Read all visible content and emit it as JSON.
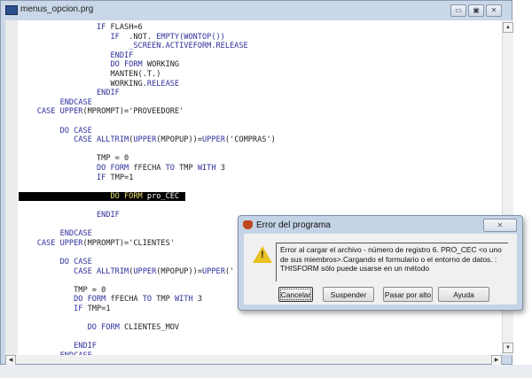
{
  "window": {
    "title": "menus_opcion.prg",
    "minimize": "▭",
    "maximize": "▣",
    "close": "✕"
  },
  "code_lines": [
    {
      "indent": 17,
      "segs": [
        {
          "t": "IF ",
          "k": "kw"
        },
        {
          "t": "FLASH=6",
          "k": ""
        }
      ]
    },
    {
      "indent": 20,
      "segs": [
        {
          "t": "IF  ",
          "k": "kw"
        },
        {
          "t": ".NOT. ",
          "k": ""
        },
        {
          "t": "EMPTY(WONTOP())",
          "k": "kw"
        }
      ]
    },
    {
      "indent": 24,
      "segs": [
        {
          "t": "_SCREEN.ACTIVEFORM.RELEASE",
          "k": "kw"
        }
      ]
    },
    {
      "indent": 20,
      "segs": [
        {
          "t": "ENDIF",
          "k": "kw"
        }
      ]
    },
    {
      "indent": 20,
      "segs": [
        {
          "t": "DO FORM ",
          "k": "kw"
        },
        {
          "t": "WORKING",
          "k": ""
        }
      ]
    },
    {
      "indent": 20,
      "segs": [
        {
          "t": "MANTEN(.T.)",
          "k": ""
        }
      ]
    },
    {
      "indent": 20,
      "segs": [
        {
          "t": "WORKING.",
          "k": ""
        },
        {
          "t": "RELEASE",
          "k": "kw"
        }
      ]
    },
    {
      "indent": 17,
      "segs": [
        {
          "t": "ENDIF",
          "k": "kw"
        }
      ]
    },
    {
      "indent": 9,
      "segs": [
        {
          "t": "ENDCASE",
          "k": "kw"
        }
      ]
    },
    {
      "indent": 4,
      "segs": [
        {
          "t": "CASE UPPER",
          "k": "kw"
        },
        {
          "t": "(MPROMPT)='PROVEEDORE'",
          "k": ""
        }
      ]
    },
    {
      "indent": 0,
      "segs": []
    },
    {
      "indent": 9,
      "segs": [
        {
          "t": "DO CASE",
          "k": "kw"
        }
      ]
    },
    {
      "indent": 12,
      "segs": [
        {
          "t": "CASE ALLTRIM",
          "k": "kw"
        },
        {
          "t": "(",
          "k": ""
        },
        {
          "t": "UPPER",
          "k": "kw"
        },
        {
          "t": "(MPOPUP))=",
          "k": ""
        },
        {
          "t": "UPPER",
          "k": "kw"
        },
        {
          "t": "('COMPRAS')",
          "k": ""
        }
      ]
    },
    {
      "indent": 0,
      "segs": []
    },
    {
      "indent": 17,
      "segs": [
        {
          "t": "TMP = 0",
          "k": ""
        }
      ]
    },
    {
      "indent": 17,
      "segs": [
        {
          "t": "DO FORM ",
          "k": "kw"
        },
        {
          "t": "fFECHA ",
          "k": ""
        },
        {
          "t": "TO ",
          "k": "kw"
        },
        {
          "t": "TMP ",
          "k": ""
        },
        {
          "t": "WITH ",
          "k": "kw"
        },
        {
          "t": "3",
          "k": ""
        }
      ]
    },
    {
      "indent": 17,
      "segs": [
        {
          "t": "IF ",
          "k": "kw"
        },
        {
          "t": "TMP=1",
          "k": ""
        }
      ]
    },
    {
      "indent": 0,
      "segs": []
    },
    {
      "indent": 20,
      "highlight": true,
      "segs": [
        {
          "t": "DO FORM ",
          "k": "kw"
        },
        {
          "t": "pro_CEC",
          "k": ""
        }
      ]
    },
    {
      "indent": 0,
      "segs": []
    },
    {
      "indent": 17,
      "segs": [
        {
          "t": "ENDIF",
          "k": "kw"
        }
      ]
    },
    {
      "indent": 0,
      "segs": []
    },
    {
      "indent": 9,
      "segs": [
        {
          "t": "ENDCASE",
          "k": "kw"
        }
      ]
    },
    {
      "indent": 4,
      "segs": [
        {
          "t": "CASE UPPER",
          "k": "kw"
        },
        {
          "t": "(MPROMPT)='CLIENTES'",
          "k": ""
        }
      ]
    },
    {
      "indent": 0,
      "segs": []
    },
    {
      "indent": 9,
      "segs": [
        {
          "t": "DO CASE",
          "k": "kw"
        }
      ]
    },
    {
      "indent": 12,
      "segs": [
        {
          "t": "CASE ALLTRIM",
          "k": "kw"
        },
        {
          "t": "(",
          "k": ""
        },
        {
          "t": "UPPER",
          "k": "kw"
        },
        {
          "t": "(MPOPUP))=",
          "k": ""
        },
        {
          "t": "UPPER",
          "k": "kw"
        },
        {
          "t": "('",
          "k": ""
        }
      ]
    },
    {
      "indent": 0,
      "segs": []
    },
    {
      "indent": 12,
      "segs": [
        {
          "t": "TMP = 0",
          "k": ""
        }
      ]
    },
    {
      "indent": 12,
      "segs": [
        {
          "t": "DO FORM ",
          "k": "kw"
        },
        {
          "t": "fFECHA ",
          "k": ""
        },
        {
          "t": "TO ",
          "k": "kw"
        },
        {
          "t": "TMP ",
          "k": ""
        },
        {
          "t": "WITH ",
          "k": "kw"
        },
        {
          "t": "3",
          "k": ""
        }
      ]
    },
    {
      "indent": 12,
      "segs": [
        {
          "t": "IF ",
          "k": "kw"
        },
        {
          "t": "TMP=1",
          "k": ""
        }
      ]
    },
    {
      "indent": 0,
      "segs": []
    },
    {
      "indent": 15,
      "segs": [
        {
          "t": "DO FORM ",
          "k": "kw"
        },
        {
          "t": "CLIENTES_MOV",
          "k": ""
        }
      ]
    },
    {
      "indent": 0,
      "segs": []
    },
    {
      "indent": 12,
      "segs": [
        {
          "t": "ENDIF",
          "k": "kw"
        }
      ]
    },
    {
      "indent": 9,
      "segs": [
        {
          "t": "ENDCASE",
          "k": "kw"
        }
      ]
    }
  ],
  "dialog": {
    "title": "Error del programa",
    "close": "✕",
    "icon": "warning-icon",
    "message": "Error al cargar el archivo - número de registro 6. PRO_CEC  <o uno de sus miembros>.Cargando el formulario o el entorno de datos. : THISFORM sólo puede usarse en un método",
    "buttons": {
      "cancel": "Cancelar",
      "suspend": "Suspender",
      "ignore": "Pasar por alto",
      "help": "Ayuda"
    }
  },
  "colors": {
    "keyword": "#2f2f9c",
    "highlight_bg": "#000000",
    "chrome": "#c9d7e8"
  }
}
